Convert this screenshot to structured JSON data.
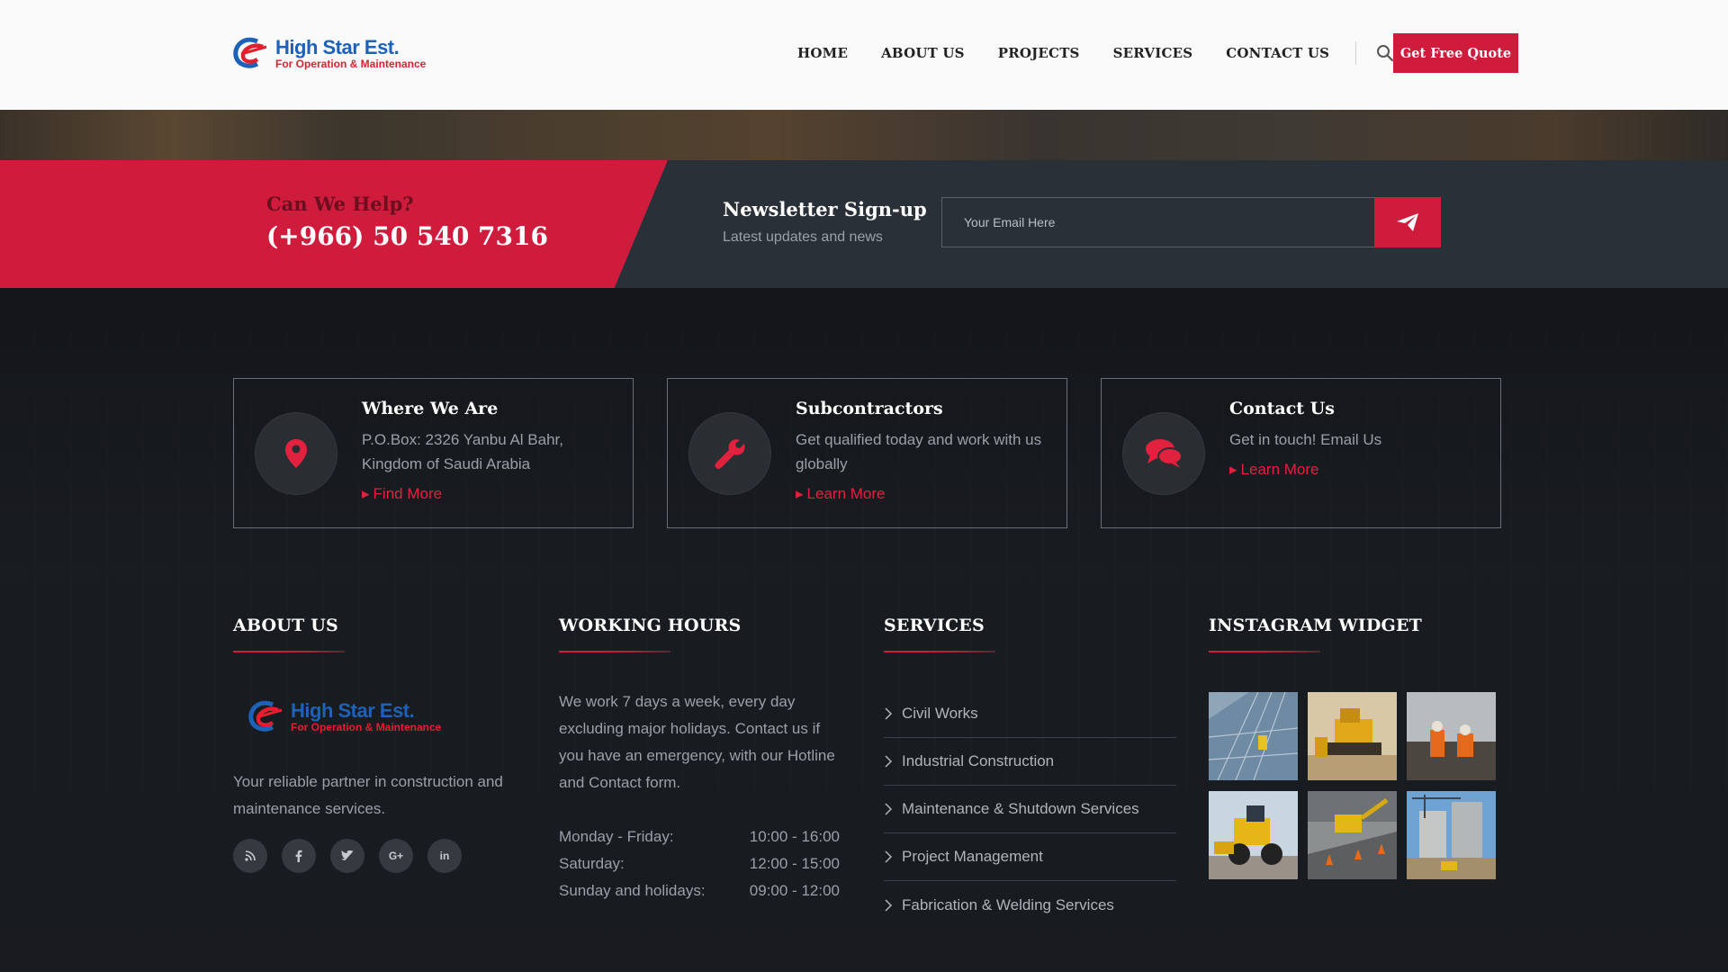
{
  "brand": {
    "name": "High Star Est.",
    "subtitle": "For Operation & Maintenance"
  },
  "nav": {
    "items": [
      "HOME",
      "ABOUT US",
      "PROJECTS",
      "SERVICES",
      "CONTACT US"
    ],
    "quote_label": "Get Free Quote"
  },
  "cta": {
    "help_label": "Can We Help?",
    "phone": "(+966) 50 540 7316",
    "newsletter_title": "Newsletter Sign-up",
    "newsletter_sub": "Latest updates and news",
    "email_placeholder": "Your Email Here"
  },
  "info_boxes": [
    {
      "title": "Where We Are",
      "text": "P.O.Box: 2326 Yanbu Al Bahr, Kingdom of Saudi Arabia",
      "link": "Find More",
      "icon": "map-marker-icon"
    },
    {
      "title": "Subcontractors",
      "text": "Get qualified today and work with us globally",
      "link": "Learn More",
      "icon": "wrench-icon"
    },
    {
      "title": "Contact Us",
      "text": "Get in touch! Email Us",
      "link": "Learn More",
      "icon": "chat-bubbles-icon"
    }
  ],
  "footer": {
    "about_heading": "ABOUT US",
    "about_text": "Your reliable partner in construction and maintenance services.",
    "social": [
      "rss-icon",
      "facebook-icon",
      "twitter-icon",
      "google-plus-icon",
      "linkedin-icon"
    ],
    "hours_heading": "WORKING HOURS",
    "hours_text": "We work 7 days a week, every day excluding major holidays. Contact us if you have an emergency, with our Hotline and Contact form.",
    "hours": [
      {
        "day": "Monday - Friday:",
        "time": "10:00 - 16:00"
      },
      {
        "day": "Saturday:",
        "time": "12:00 - 15:00"
      },
      {
        "day": "Sunday and holidays:",
        "time": "09:00 - 12:00"
      }
    ],
    "services_heading": "SERVICES",
    "services": [
      "Civil Works",
      "Industrial Construction",
      "Maintenance & Shutdown Services",
      "Project Management",
      "Fabrication & Welding Services"
    ],
    "instagram_heading": "INSTAGRAM WIDGET"
  },
  "colors": {
    "accent": "#cf1b3c",
    "dark_bar": "#293038",
    "brand_blue": "#1d62b8"
  }
}
